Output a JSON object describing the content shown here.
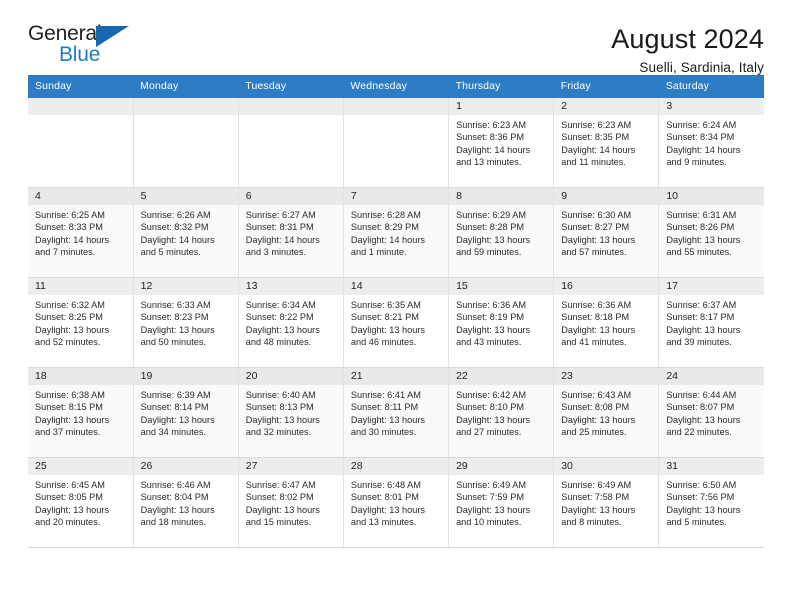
{
  "brand": {
    "name_part1": "General",
    "name_part2": "Blue",
    "mark": "triangle-logo"
  },
  "header": {
    "title": "August 2024",
    "subtitle": "Suelli, Sardinia, Italy"
  },
  "calendar": {
    "weekday_headers": [
      "Sunday",
      "Monday",
      "Tuesday",
      "Wednesday",
      "Thursday",
      "Friday",
      "Saturday"
    ],
    "accent_color": "#2e7cc4",
    "daynum_bar_color": "#ededed",
    "weeks": [
      [
        {
          "day": "",
          "empty": true
        },
        {
          "day": "",
          "empty": true
        },
        {
          "day": "",
          "empty": true
        },
        {
          "day": "",
          "empty": true
        },
        {
          "day": "1",
          "sunrise": "Sunrise: 6:23 AM",
          "sunset": "Sunset: 8:36 PM",
          "daylight_1": "Daylight: 14 hours",
          "daylight_2": "and 13 minutes."
        },
        {
          "day": "2",
          "sunrise": "Sunrise: 6:23 AM",
          "sunset": "Sunset: 8:35 PM",
          "daylight_1": "Daylight: 14 hours",
          "daylight_2": "and 11 minutes."
        },
        {
          "day": "3",
          "sunrise": "Sunrise: 6:24 AM",
          "sunset": "Sunset: 8:34 PM",
          "daylight_1": "Daylight: 14 hours",
          "daylight_2": "and 9 minutes."
        }
      ],
      [
        {
          "day": "4",
          "sunrise": "Sunrise: 6:25 AM",
          "sunset": "Sunset: 8:33 PM",
          "daylight_1": "Daylight: 14 hours",
          "daylight_2": "and 7 minutes."
        },
        {
          "day": "5",
          "sunrise": "Sunrise: 6:26 AM",
          "sunset": "Sunset: 8:32 PM",
          "daylight_1": "Daylight: 14 hours",
          "daylight_2": "and 5 minutes."
        },
        {
          "day": "6",
          "sunrise": "Sunrise: 6:27 AM",
          "sunset": "Sunset: 8:31 PM",
          "daylight_1": "Daylight: 14 hours",
          "daylight_2": "and 3 minutes."
        },
        {
          "day": "7",
          "sunrise": "Sunrise: 6:28 AM",
          "sunset": "Sunset: 8:29 PM",
          "daylight_1": "Daylight: 14 hours",
          "daylight_2": "and 1 minute."
        },
        {
          "day": "8",
          "sunrise": "Sunrise: 6:29 AM",
          "sunset": "Sunset: 8:28 PM",
          "daylight_1": "Daylight: 13 hours",
          "daylight_2": "and 59 minutes."
        },
        {
          "day": "9",
          "sunrise": "Sunrise: 6:30 AM",
          "sunset": "Sunset: 8:27 PM",
          "daylight_1": "Daylight: 13 hours",
          "daylight_2": "and 57 minutes."
        },
        {
          "day": "10",
          "sunrise": "Sunrise: 6:31 AM",
          "sunset": "Sunset: 8:26 PM",
          "daylight_1": "Daylight: 13 hours",
          "daylight_2": "and 55 minutes."
        }
      ],
      [
        {
          "day": "11",
          "sunrise": "Sunrise: 6:32 AM",
          "sunset": "Sunset: 8:25 PM",
          "daylight_1": "Daylight: 13 hours",
          "daylight_2": "and 52 minutes."
        },
        {
          "day": "12",
          "sunrise": "Sunrise: 6:33 AM",
          "sunset": "Sunset: 8:23 PM",
          "daylight_1": "Daylight: 13 hours",
          "daylight_2": "and 50 minutes."
        },
        {
          "day": "13",
          "sunrise": "Sunrise: 6:34 AM",
          "sunset": "Sunset: 8:22 PM",
          "daylight_1": "Daylight: 13 hours",
          "daylight_2": "and 48 minutes."
        },
        {
          "day": "14",
          "sunrise": "Sunrise: 6:35 AM",
          "sunset": "Sunset: 8:21 PM",
          "daylight_1": "Daylight: 13 hours",
          "daylight_2": "and 46 minutes."
        },
        {
          "day": "15",
          "sunrise": "Sunrise: 6:36 AM",
          "sunset": "Sunset: 8:19 PM",
          "daylight_1": "Daylight: 13 hours",
          "daylight_2": "and 43 minutes."
        },
        {
          "day": "16",
          "sunrise": "Sunrise: 6:36 AM",
          "sunset": "Sunset: 8:18 PM",
          "daylight_1": "Daylight: 13 hours",
          "daylight_2": "and 41 minutes."
        },
        {
          "day": "17",
          "sunrise": "Sunrise: 6:37 AM",
          "sunset": "Sunset: 8:17 PM",
          "daylight_1": "Daylight: 13 hours",
          "daylight_2": "and 39 minutes."
        }
      ],
      [
        {
          "day": "18",
          "sunrise": "Sunrise: 6:38 AM",
          "sunset": "Sunset: 8:15 PM",
          "daylight_1": "Daylight: 13 hours",
          "daylight_2": "and 37 minutes."
        },
        {
          "day": "19",
          "sunrise": "Sunrise: 6:39 AM",
          "sunset": "Sunset: 8:14 PM",
          "daylight_1": "Daylight: 13 hours",
          "daylight_2": "and 34 minutes."
        },
        {
          "day": "20",
          "sunrise": "Sunrise: 6:40 AM",
          "sunset": "Sunset: 8:13 PM",
          "daylight_1": "Daylight: 13 hours",
          "daylight_2": "and 32 minutes."
        },
        {
          "day": "21",
          "sunrise": "Sunrise: 6:41 AM",
          "sunset": "Sunset: 8:11 PM",
          "daylight_1": "Daylight: 13 hours",
          "daylight_2": "and 30 minutes."
        },
        {
          "day": "22",
          "sunrise": "Sunrise: 6:42 AM",
          "sunset": "Sunset: 8:10 PM",
          "daylight_1": "Daylight: 13 hours",
          "daylight_2": "and 27 minutes."
        },
        {
          "day": "23",
          "sunrise": "Sunrise: 6:43 AM",
          "sunset": "Sunset: 8:08 PM",
          "daylight_1": "Daylight: 13 hours",
          "daylight_2": "and 25 minutes."
        },
        {
          "day": "24",
          "sunrise": "Sunrise: 6:44 AM",
          "sunset": "Sunset: 8:07 PM",
          "daylight_1": "Daylight: 13 hours",
          "daylight_2": "and 22 minutes."
        }
      ],
      [
        {
          "day": "25",
          "sunrise": "Sunrise: 6:45 AM",
          "sunset": "Sunset: 8:05 PM",
          "daylight_1": "Daylight: 13 hours",
          "daylight_2": "and 20 minutes."
        },
        {
          "day": "26",
          "sunrise": "Sunrise: 6:46 AM",
          "sunset": "Sunset: 8:04 PM",
          "daylight_1": "Daylight: 13 hours",
          "daylight_2": "and 18 minutes."
        },
        {
          "day": "27",
          "sunrise": "Sunrise: 6:47 AM",
          "sunset": "Sunset: 8:02 PM",
          "daylight_1": "Daylight: 13 hours",
          "daylight_2": "and 15 minutes."
        },
        {
          "day": "28",
          "sunrise": "Sunrise: 6:48 AM",
          "sunset": "Sunset: 8:01 PM",
          "daylight_1": "Daylight: 13 hours",
          "daylight_2": "and 13 minutes."
        },
        {
          "day": "29",
          "sunrise": "Sunrise: 6:49 AM",
          "sunset": "Sunset: 7:59 PM",
          "daylight_1": "Daylight: 13 hours",
          "daylight_2": "and 10 minutes."
        },
        {
          "day": "30",
          "sunrise": "Sunrise: 6:49 AM",
          "sunset": "Sunset: 7:58 PM",
          "daylight_1": "Daylight: 13 hours",
          "daylight_2": "and 8 minutes."
        },
        {
          "day": "31",
          "sunrise": "Sunrise: 6:50 AM",
          "sunset": "Sunset: 7:56 PM",
          "daylight_1": "Daylight: 13 hours",
          "daylight_2": "and 5 minutes."
        }
      ]
    ]
  }
}
